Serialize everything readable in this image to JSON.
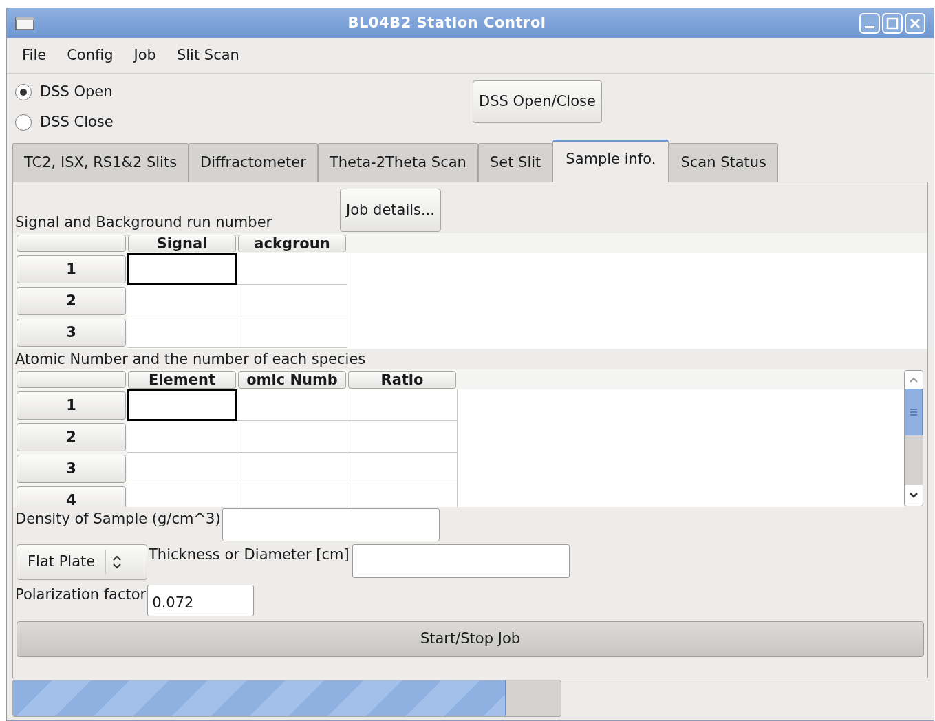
{
  "window": {
    "title": "BL04B2 Station Control"
  },
  "menu": [
    "File",
    "Config",
    "Job",
    "Slit Scan"
  ],
  "radios": [
    {
      "label": "DSS Open",
      "selected": true
    },
    {
      "label": "DSS Close",
      "selected": false
    }
  ],
  "dss_button": "DSS Open/Close",
  "tabs": [
    {
      "label": "TC2, ISX, RS1&2 Slits",
      "selected": false
    },
    {
      "label": "Diffractometer",
      "selected": false
    },
    {
      "label": "Theta-2Theta Scan",
      "selected": false
    },
    {
      "label": "Set Slit",
      "selected": false
    },
    {
      "label": "Sample info.",
      "selected": true
    },
    {
      "label": "Scan Status",
      "selected": false
    }
  ],
  "job_details_button": "Job details...",
  "run_table": {
    "title": "Signal and Background run number",
    "columns": [
      "Signal",
      "ackgroun"
    ],
    "rows": [
      "1",
      "2",
      "3"
    ],
    "cursor_on_first_cell": true
  },
  "species_table": {
    "title": "Atomic Number and the number of each species",
    "columns": [
      "Element",
      "omic Numb",
      "Ratio"
    ],
    "rows": [
      "1",
      "2",
      "3",
      "4"
    ],
    "cursor_on_first_cell": true
  },
  "density": {
    "label": "Density of Sample (g/cm^3)"
  },
  "geometry_select": {
    "value": "Flat Plate"
  },
  "thickness": {
    "label": "Thickness or Diameter [cm]"
  },
  "polarization": {
    "label": "Polarization factor",
    "value": "0.072"
  },
  "start_button": "Start/Stop Job",
  "progress": {
    "level": 0.9
  }
}
